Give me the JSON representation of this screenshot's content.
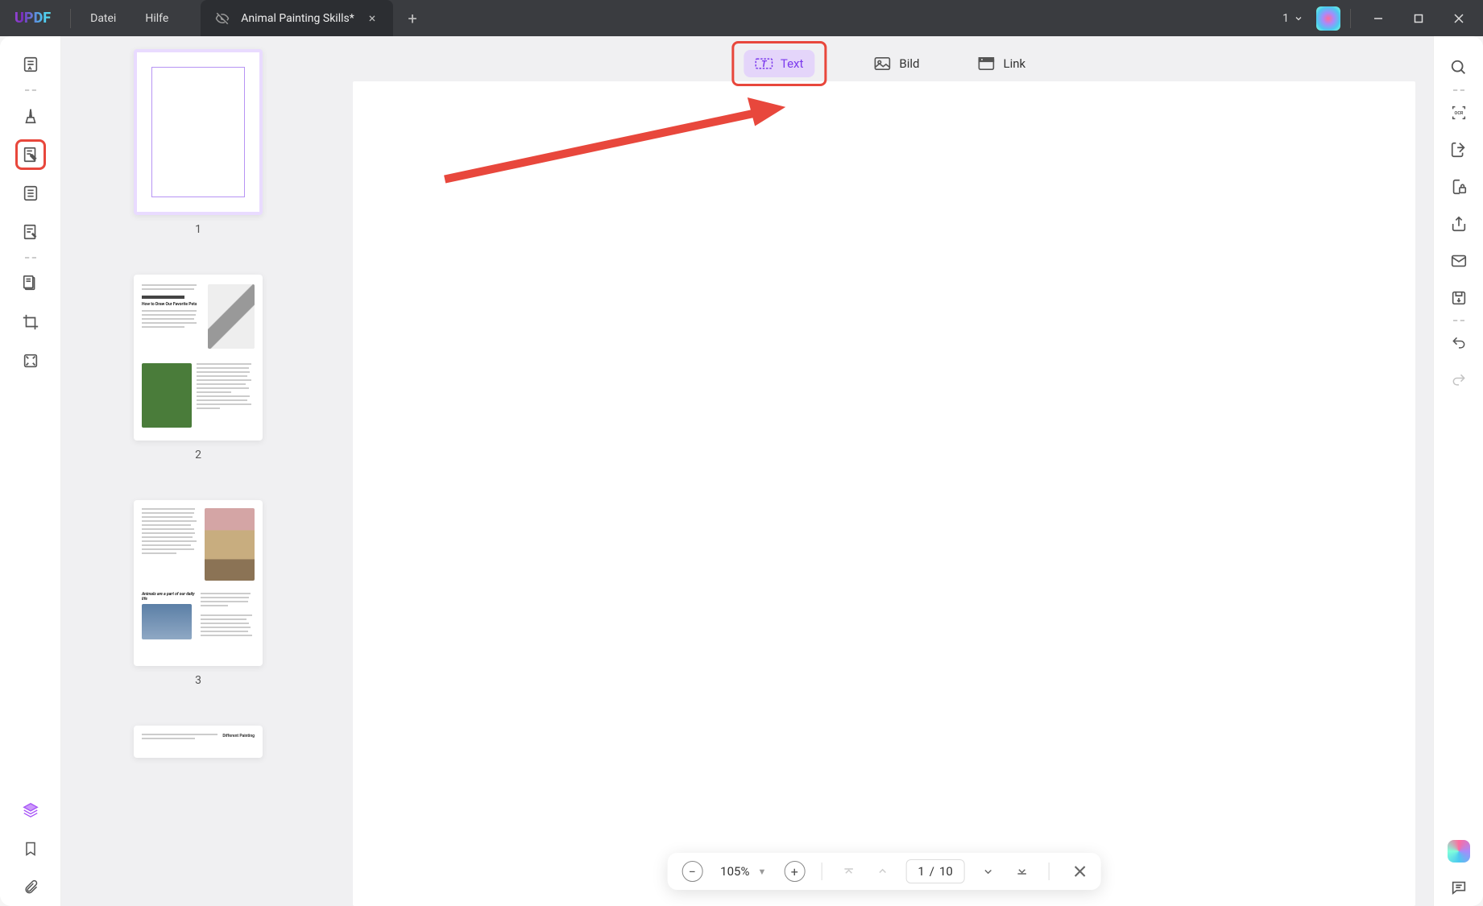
{
  "titlebar": {
    "logo": "UPDF",
    "menu_file": "Datei",
    "menu_help": "Hilfe",
    "tab_title": "Animal Painting Skills*",
    "tab_close": "×",
    "tab_add": "+",
    "window_count": "1"
  },
  "edit_toolbar": {
    "text": "Text",
    "image": "Bild",
    "link": "Link"
  },
  "thumbnails": {
    "p1": "1",
    "p2": "2",
    "p3": "3",
    "p2_heading": "How to Draw Our Favorite Pets",
    "p3_heading": "Animals are a part of our daily life"
  },
  "zoom": {
    "value": "105%",
    "current_page": "1",
    "sep": "/",
    "total_pages": "10"
  }
}
